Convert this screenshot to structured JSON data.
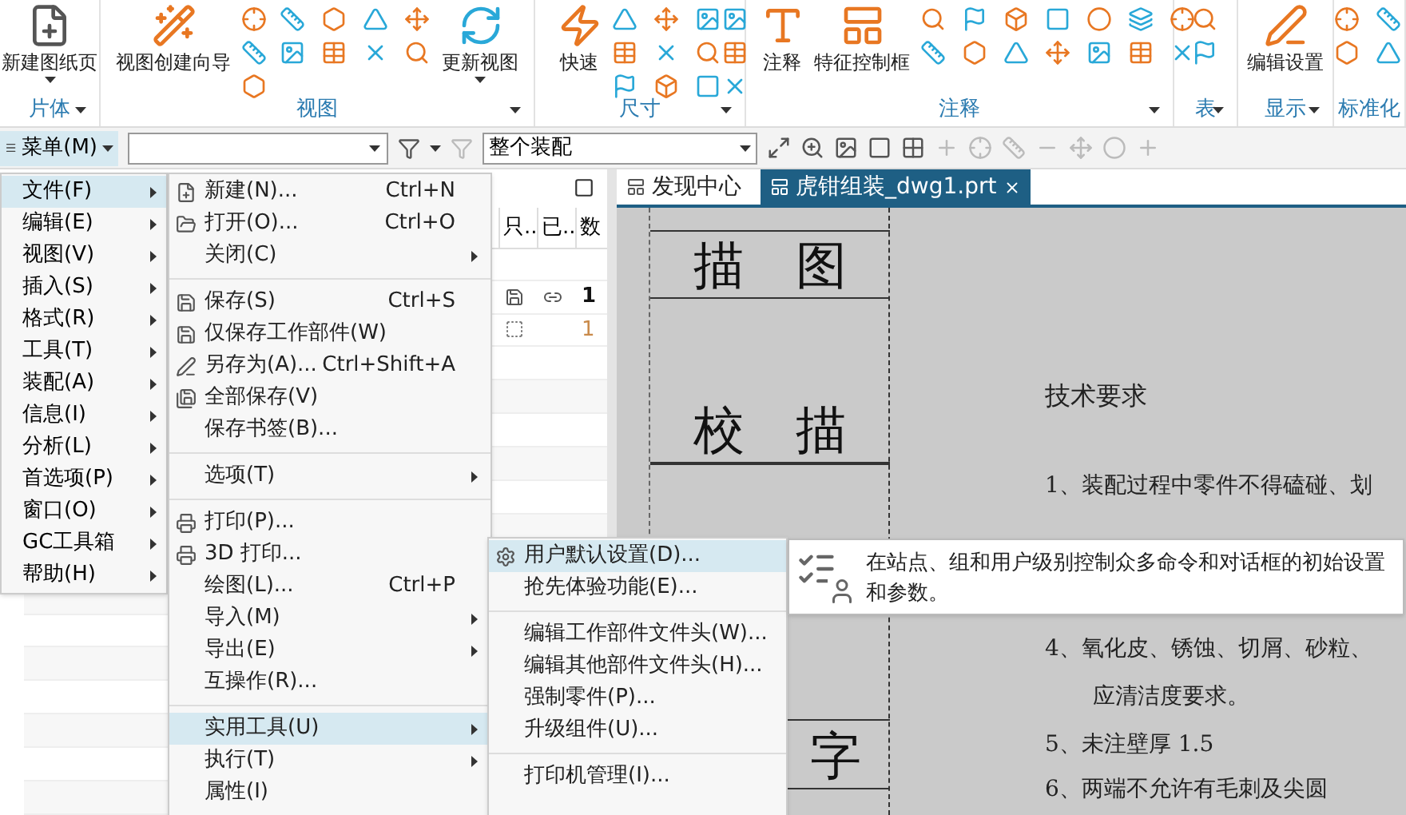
{
  "ribbon": {
    "groups": [
      {
        "label": "片体",
        "has_menu": true,
        "buttons": [
          {
            "label": "新建图纸页",
            "has_menu": true
          }
        ]
      },
      {
        "label": "视图",
        "has_menu": true,
        "buttons": [
          {
            "label": "视图创建向导",
            "has_menu": false
          },
          {
            "label": "更新视图",
            "has_menu": true
          }
        ]
      },
      {
        "label": "尺寸",
        "has_menu": true,
        "buttons": [
          {
            "label": "快速",
            "has_menu": false
          }
        ]
      },
      {
        "label": "注释",
        "has_menu": true,
        "buttons": [
          {
            "label": "注释",
            "has_menu": false
          },
          {
            "label": "特征控制框",
            "has_menu": false
          }
        ]
      },
      {
        "label": "表",
        "has_menu": true
      },
      {
        "label": "显示",
        "has_menu": true,
        "buttons": [
          {
            "label": "编辑设置",
            "has_menu": false
          }
        ]
      },
      {
        "label": "标准化",
        "has_menu": false
      }
    ]
  },
  "toolbar": {
    "menu_button": "菜单(M)",
    "scope_dropdown": "整个装配"
  },
  "doc_tabs": [
    {
      "label": "发现中心",
      "selected": false
    },
    {
      "label": "虎钳组装_dwg1.prt",
      "selected": true
    }
  ],
  "navigator": {
    "columns": [
      "只..",
      "已..",
      "数"
    ],
    "rows": [
      {
        "kind": "loaded",
        "value": "1"
      },
      {
        "kind": "unloaded",
        "value": "1"
      }
    ]
  },
  "main_menu": [
    {
      "label": "文件(F)",
      "selected": true
    },
    {
      "label": "编辑(E)",
      "selected": false
    },
    {
      "label": "视图(V)",
      "selected": false
    },
    {
      "label": "插入(S)",
      "selected": false
    },
    {
      "label": "格式(R)",
      "selected": false
    },
    {
      "label": "工具(T)",
      "selected": false
    },
    {
      "label": "装配(A)",
      "selected": false
    },
    {
      "label": "信息(I)",
      "selected": false
    },
    {
      "label": "分析(L)",
      "selected": false
    },
    {
      "label": "首选项(P)",
      "selected": false
    },
    {
      "label": "窗口(O)",
      "selected": false
    },
    {
      "label": "GC工具箱",
      "selected": false
    },
    {
      "label": "帮助(H)",
      "selected": false
    }
  ],
  "file_menu": [
    [
      {
        "label": "新建(N)...",
        "shortcut": "Ctrl+N",
        "submenu": false,
        "selected": false
      },
      {
        "label": "打开(O)...",
        "shortcut": "Ctrl+O",
        "submenu": false,
        "selected": false
      },
      {
        "label": "关闭(C)",
        "submenu": true,
        "selected": false
      }
    ],
    [
      {
        "label": "保存(S)",
        "shortcut": "Ctrl+S",
        "submenu": false,
        "selected": false
      },
      {
        "label": "仅保存工作部件(W)",
        "submenu": false,
        "selected": false
      },
      {
        "label": "另存为(A)...",
        "shortcut": "Ctrl+Shift+A",
        "submenu": false,
        "selected": false
      },
      {
        "label": "全部保存(V)",
        "submenu": false,
        "selected": false
      },
      {
        "label": "保存书签(B)...",
        "submenu": false,
        "selected": false
      }
    ],
    [
      {
        "label": "选项(T)",
        "submenu": true,
        "selected": false
      }
    ],
    [
      {
        "label": "打印(P)...",
        "submenu": false,
        "selected": false
      },
      {
        "label": "3D 打印...",
        "submenu": false,
        "selected": false
      },
      {
        "label": "绘图(L)...",
        "shortcut": "Ctrl+P",
        "submenu": false,
        "selected": false
      },
      {
        "label": "导入(M)",
        "submenu": true,
        "selected": false
      },
      {
        "label": "导出(E)",
        "submenu": true,
        "selected": false
      },
      {
        "label": "互操作(R)...",
        "submenu": false,
        "selected": false
      }
    ],
    [
      {
        "label": "实用工具(U)",
        "submenu": true,
        "selected": true
      },
      {
        "label": "执行(T)",
        "submenu": true,
        "selected": false
      },
      {
        "label": "属性(I)",
        "submenu": false,
        "selected": false
      }
    ]
  ],
  "utility_menu": [
    [
      {
        "label": "用户默认设置(D)...",
        "selected": true
      },
      {
        "label": "抢先体验功能(E)...",
        "selected": false
      }
    ],
    [
      {
        "label": "编辑工作部件文件头(W)...",
        "selected": false
      },
      {
        "label": "编辑其他部件文件头(H)...",
        "selected": false
      },
      {
        "label": "强制零件(P)...",
        "selected": false
      },
      {
        "label": "升级组件(U)...",
        "selected": false
      }
    ],
    [
      {
        "label": "打印机管理(I)...",
        "selected": false
      }
    ]
  ],
  "tooltip": "在站点、组和用户级别控制众多命令和对话框的初始设置和参数。",
  "drawing": {
    "title_block": [
      "描 图",
      "校 描",
      "字"
    ],
    "notes_title": "技术要求",
    "notes": [
      {
        "kind": "numbered",
        "text": "1、装配过程中零件不得磕碰、划"
      },
      {
        "kind": "numbered",
        "text": "4、氧化皮、锈蚀、切屑、砂粒、"
      },
      {
        "kind": "continuation",
        "text": "应清洁度要求。"
      },
      {
        "kind": "numbered",
        "text": "5、未注壁厚  1.5"
      },
      {
        "kind": "numbered",
        "text": "6、两端不允许有毛刺及尖圆"
      }
    ]
  }
}
